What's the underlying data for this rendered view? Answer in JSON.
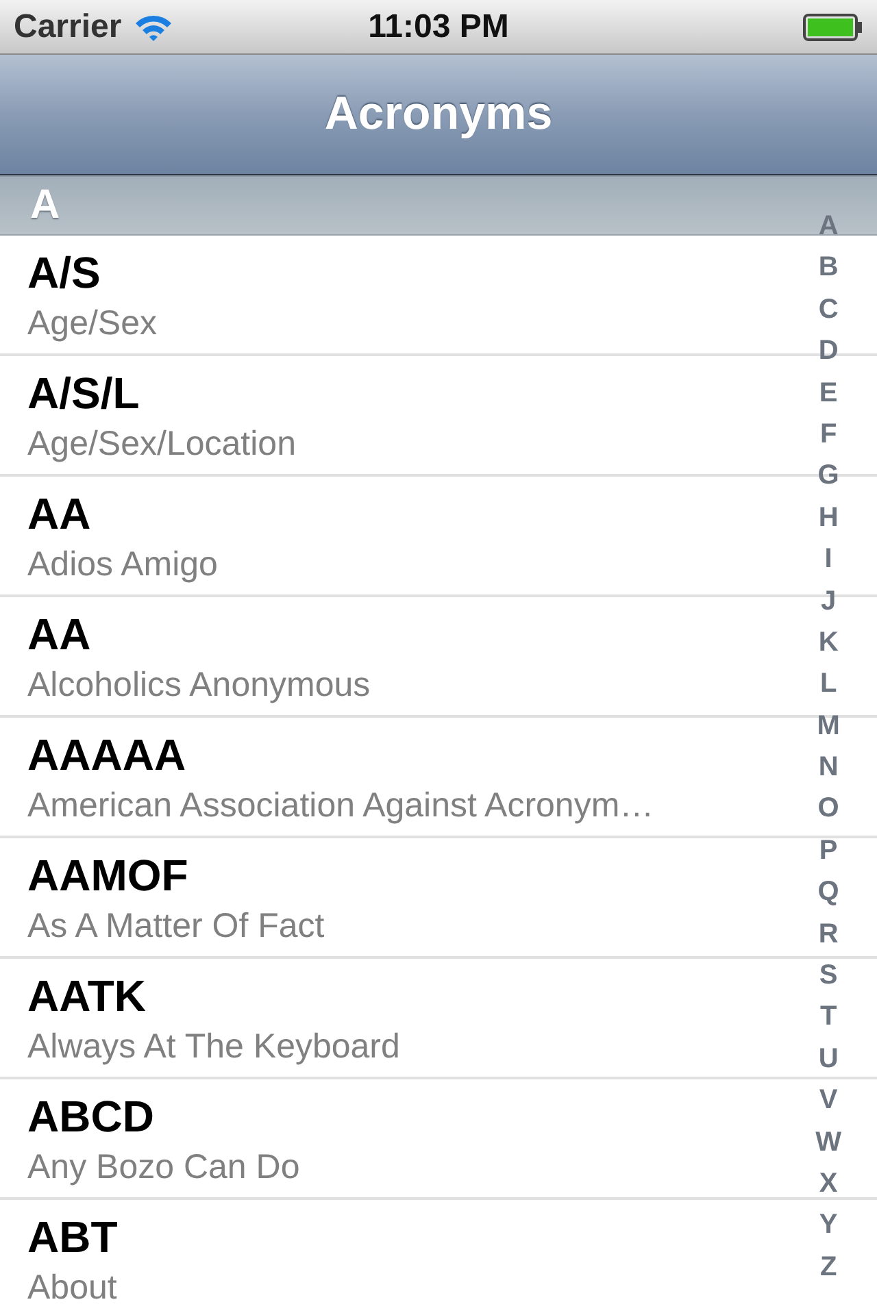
{
  "status_bar": {
    "carrier": "Carrier",
    "time": "11:03 PM"
  },
  "nav_bar": {
    "title": "Acronyms"
  },
  "section": {
    "title": "A"
  },
  "rows": [
    {
      "title": "A/S",
      "subtitle": "Age/Sex"
    },
    {
      "title": "A/S/L",
      "subtitle": "Age/Sex/Location"
    },
    {
      "title": "AA",
      "subtitle": "Adios Amigo"
    },
    {
      "title": "AA",
      "subtitle": "Alcoholics Anonymous"
    },
    {
      "title": "AAAAA",
      "subtitle": "American Association Against Acronym…"
    },
    {
      "title": "AAMOF",
      "subtitle": "As A Matter Of Fact"
    },
    {
      "title": "AATK",
      "subtitle": "Always At The Keyboard"
    },
    {
      "title": "ABCD",
      "subtitle": "Any Bozo Can Do"
    },
    {
      "title": "ABT",
      "subtitle": "About"
    }
  ],
  "index": [
    "A",
    "B",
    "C",
    "D",
    "E",
    "F",
    "G",
    "H",
    "I",
    "J",
    "K",
    "L",
    "M",
    "N",
    "O",
    "P",
    "Q",
    "R",
    "S",
    "T",
    "U",
    "V",
    "W",
    "X",
    "Y",
    "Z"
  ]
}
